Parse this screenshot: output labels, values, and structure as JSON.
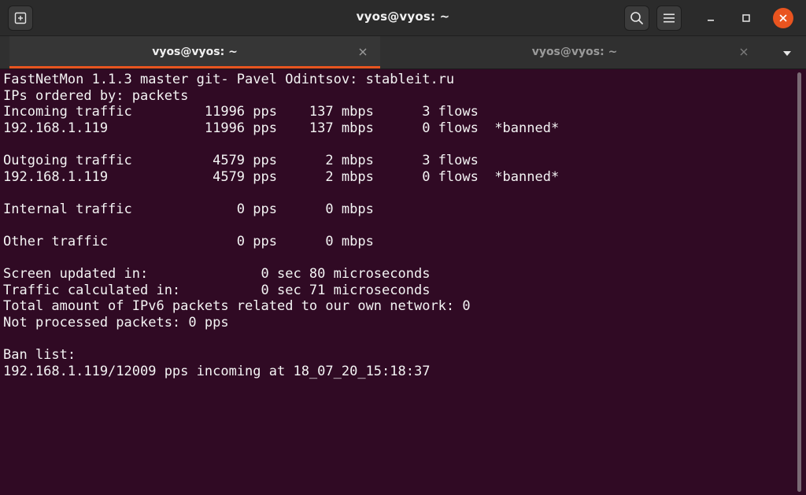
{
  "window": {
    "title": "vyos@vyos: ~"
  },
  "tabs": [
    {
      "label": "vyos@vyos: ~",
      "active": true
    },
    {
      "label": "vyos@vyos: ~",
      "active": false
    }
  ],
  "icons": {
    "new_tab": "new-tab-icon",
    "search": "search-icon",
    "menu": "hamburger-menu-icon",
    "minimize": "minimize-icon",
    "maximize": "maximize-icon",
    "close": "close-icon",
    "tab_close": "close-icon",
    "tab_list": "chevron-down-icon"
  },
  "colors": {
    "terminal_background": "#300a24",
    "terminal_foreground": "#f4f4f4",
    "accent": "#e95420"
  },
  "terminal": {
    "lines": [
      "FastNetMon 1.1.3 master git- Pavel Odintsov: stableit.ru",
      "IPs ordered by: packets",
      "Incoming traffic         11996 pps    137 mbps      3 flows",
      "192.168.1.119            11996 pps    137 mbps      0 flows  *banned*",
      "",
      "Outgoing traffic          4579 pps      2 mbps      3 flows",
      "192.168.1.119             4579 pps      2 mbps      0 flows  *banned*",
      "",
      "Internal traffic             0 pps      0 mbps",
      "",
      "Other traffic                0 pps      0 mbps",
      "",
      "Screen updated in:              0 sec 80 microseconds",
      "Traffic calculated in:          0 sec 71 microseconds",
      "Total amount of IPv6 packets related to our own network: 0",
      "Not processed packets: 0 pps",
      "",
      "Ban list:",
      "192.168.1.119/12009 pps incoming at 18_07_20_15:18:37"
    ]
  }
}
